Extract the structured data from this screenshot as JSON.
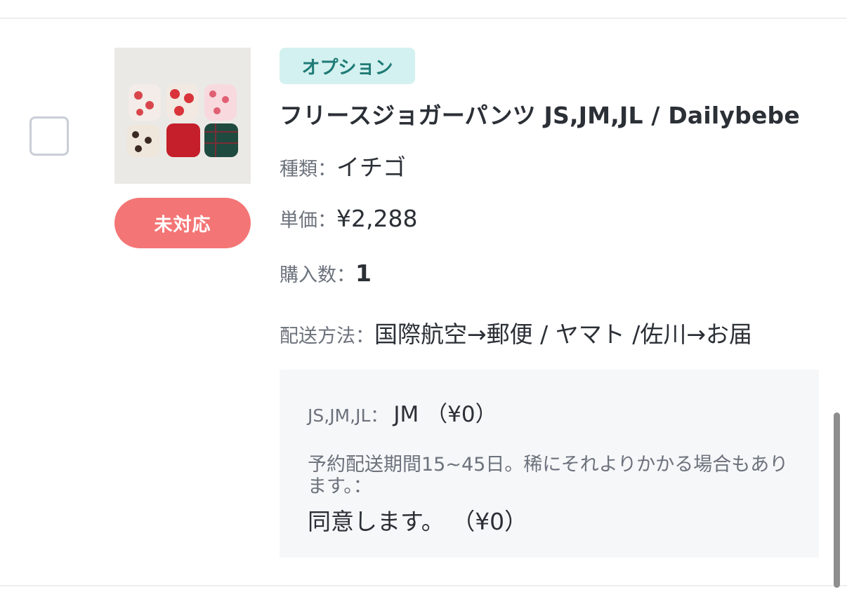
{
  "item": {
    "status": "未対応",
    "tag": "オプション",
    "title": "フリースジョガーパンツ JS,JM,JL / Dailybebe",
    "image_alt": "Dailybebe fleece jogger pants",
    "rows": [
      {
        "label": "種類：",
        "value": "イチゴ"
      },
      {
        "label": "単価：",
        "value": "¥2,288"
      },
      {
        "label": "購入数：",
        "value": "1"
      },
      {
        "label": "配送方法：",
        "value": "国際航空→郵便 / ヤマト /佐川→お届"
      }
    ],
    "options": {
      "size_label": "JS,JM,JL：",
      "size_value": "JM （¥0）",
      "notice_label": "予約配送期間15~45日。稀にそれよりかかる場合もあります。：",
      "notice_value": "同意します。 （¥0）"
    }
  },
  "colors": {
    "status_bg": "#f47575",
    "tag_bg": "#d3f1f0",
    "tag_text": "#1f7a76",
    "option_box_bg": "#f6f7f9"
  }
}
